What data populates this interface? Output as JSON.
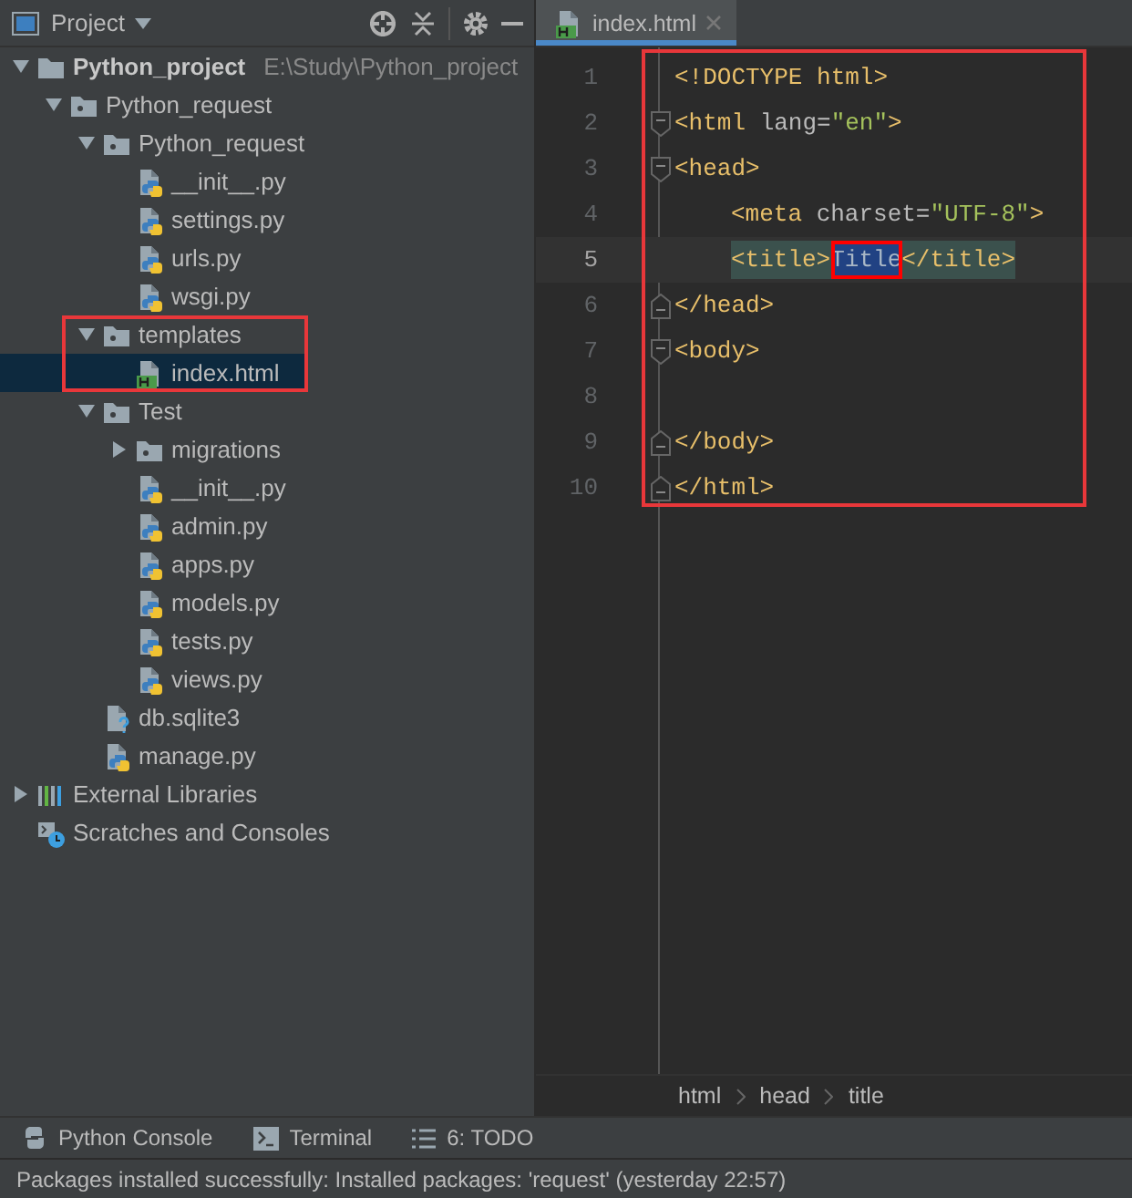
{
  "project_panel": {
    "title": "Project",
    "tree": [
      {
        "label": "Python_project",
        "path": "E:\\Study\\Python_project",
        "kind": "project",
        "expanded": true,
        "selected": false,
        "children": [
          {
            "label": "Python_request",
            "kind": "package",
            "expanded": true,
            "selected": false,
            "children": [
              {
                "label": "Python_request",
                "kind": "package",
                "expanded": true,
                "selected": false,
                "children": [
                  {
                    "label": "__init__.py",
                    "kind": "python",
                    "selected": false
                  },
                  {
                    "label": "settings.py",
                    "kind": "python",
                    "selected": false
                  },
                  {
                    "label": "urls.py",
                    "kind": "python",
                    "selected": false
                  },
                  {
                    "label": "wsgi.py",
                    "kind": "python",
                    "selected": false
                  }
                ]
              },
              {
                "label": "templates",
                "kind": "package",
                "expanded": true,
                "selected": false,
                "annotated": true,
                "children": [
                  {
                    "label": "index.html",
                    "kind": "html",
                    "selected": true
                  }
                ]
              },
              {
                "label": "Test",
                "kind": "package",
                "expanded": true,
                "selected": false,
                "children": [
                  {
                    "label": "migrations",
                    "kind": "package",
                    "expanded": false,
                    "selected": false
                  },
                  {
                    "label": "__init__.py",
                    "kind": "python",
                    "selected": false
                  },
                  {
                    "label": "admin.py",
                    "kind": "python",
                    "selected": false
                  },
                  {
                    "label": "apps.py",
                    "kind": "python",
                    "selected": false
                  },
                  {
                    "label": "models.py",
                    "kind": "python",
                    "selected": false
                  },
                  {
                    "label": "tests.py",
                    "kind": "python",
                    "selected": false
                  },
                  {
                    "label": "views.py",
                    "kind": "python",
                    "selected": false
                  }
                ]
              },
              {
                "label": "db.sqlite3",
                "kind": "unknown",
                "selected": false
              },
              {
                "label": "manage.py",
                "kind": "python",
                "selected": false
              }
            ]
          }
        ]
      },
      {
        "label": "External Libraries",
        "kind": "libraries",
        "expanded": false,
        "selected": false
      },
      {
        "label": "Scratches and Consoles",
        "kind": "scratches",
        "selected": false
      }
    ]
  },
  "editor": {
    "tabs": [
      {
        "label": "index.html",
        "kind": "html",
        "selected": true
      }
    ],
    "annotated": true,
    "lines": [
      {
        "number": "1",
        "indented": false,
        "current": false,
        "tokens": [
          {
            "text": "<!DOCTYPE html>",
            "kind": "tag"
          }
        ]
      },
      {
        "number": "2",
        "indented": false,
        "current": false,
        "kind": "opener",
        "tokens": [
          {
            "text": "<html",
            "kind": "tag"
          },
          {
            "text": " lang=",
            "kind": "attr"
          },
          {
            "text": "\"en\"",
            "kind": "value"
          },
          {
            "text": ">",
            "kind": "tag"
          }
        ]
      },
      {
        "number": "3",
        "indented": false,
        "current": false,
        "kind": "opener",
        "tokens": [
          {
            "text": "<head>",
            "kind": "tag"
          }
        ]
      },
      {
        "number": "4",
        "indented": true,
        "current": false,
        "tokens": [
          {
            "text": "<meta",
            "kind": "tag"
          },
          {
            "text": " charset=",
            "kind": "attr"
          },
          {
            "text": "\"UTF-8\"",
            "kind": "value"
          },
          {
            "text": ">",
            "kind": "tag"
          }
        ]
      },
      {
        "number": "5",
        "indented": true,
        "current": true,
        "tokens": [
          {
            "text": "<title>",
            "kind": "tag",
            "matched": true,
            "selected": false,
            "annotated": false
          },
          {
            "text": "Title",
            "kind": "text",
            "matched": true,
            "selected": true,
            "annotated": true
          },
          {
            "text": "</title>",
            "kind": "tag",
            "matched": true,
            "selected": false,
            "annotated": false
          }
        ]
      },
      {
        "number": "6",
        "indented": false,
        "current": false,
        "kind": "closer",
        "tokens": [
          {
            "text": "</head>",
            "kind": "tag"
          }
        ]
      },
      {
        "number": "7",
        "indented": false,
        "current": false,
        "kind": "opener",
        "tokens": [
          {
            "text": "<body>",
            "kind": "tag"
          }
        ]
      },
      {
        "number": "8",
        "current": false
      },
      {
        "number": "9",
        "indented": false,
        "current": false,
        "kind": "closer",
        "tokens": [
          {
            "text": "</body>",
            "kind": "tag"
          }
        ]
      },
      {
        "number": "10",
        "indented": false,
        "current": false,
        "kind": "closer",
        "tokens": [
          {
            "text": "</html>",
            "kind": "tag"
          }
        ]
      }
    ],
    "breadcrumbs": [
      "html",
      "head",
      "title"
    ]
  },
  "tool_windows": [
    {
      "label": "Python Console",
      "kind": "python"
    },
    {
      "label": "Terminal",
      "kind": "terminal"
    },
    {
      "label": "6: TODO",
      "kind": "todo"
    }
  ],
  "status_bar": "Packages installed successfully: Installed packages: 'request' (yesterday 22:57)"
}
